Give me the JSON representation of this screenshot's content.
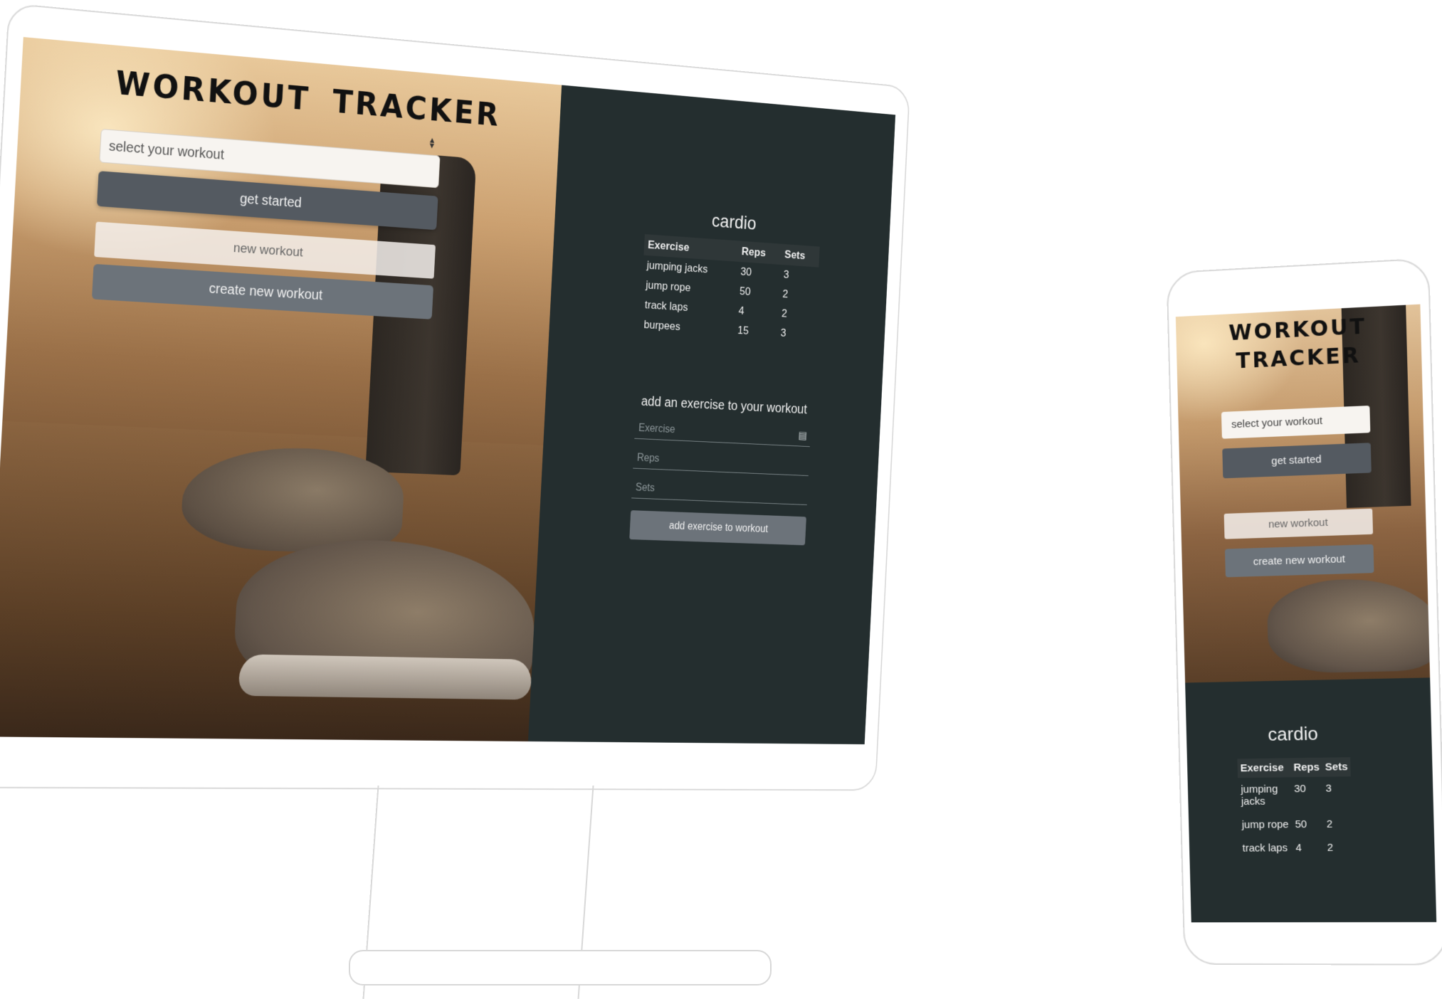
{
  "app": {
    "title_words": [
      "WORKOUT",
      "TRACKER"
    ]
  },
  "form": {
    "select_placeholder": "select your workout",
    "get_started_label": "get started",
    "new_workout_placeholder": "new workout",
    "create_label": "create new workout"
  },
  "workout": {
    "name": "cardio",
    "columns": [
      "Exercise",
      "Reps",
      "Sets"
    ],
    "rows": [
      {
        "exercise": "jumping jacks",
        "reps": "30",
        "sets": "3"
      },
      {
        "exercise": "jump rope",
        "reps": "50",
        "sets": "2"
      },
      {
        "exercise": "track laps",
        "reps": "4",
        "sets": "2"
      },
      {
        "exercise": "burpees",
        "reps": "15",
        "sets": "3"
      }
    ]
  },
  "add_exercise": {
    "title": "add an exercise to your workout",
    "exercise_placeholder": "Exercise",
    "reps_placeholder": "Reps",
    "sets_placeholder": "Sets",
    "submit_label": "add exercise to workout"
  },
  "mobile": {
    "title_lines": [
      "WORKOUT",
      "TRACKER"
    ],
    "rows": [
      {
        "exercise": "jumping jacks",
        "reps": "30",
        "sets": "3"
      },
      {
        "exercise": "jump rope",
        "reps": "50",
        "sets": "2"
      },
      {
        "exercise": "track laps",
        "reps": "4",
        "sets": "2"
      }
    ]
  }
}
